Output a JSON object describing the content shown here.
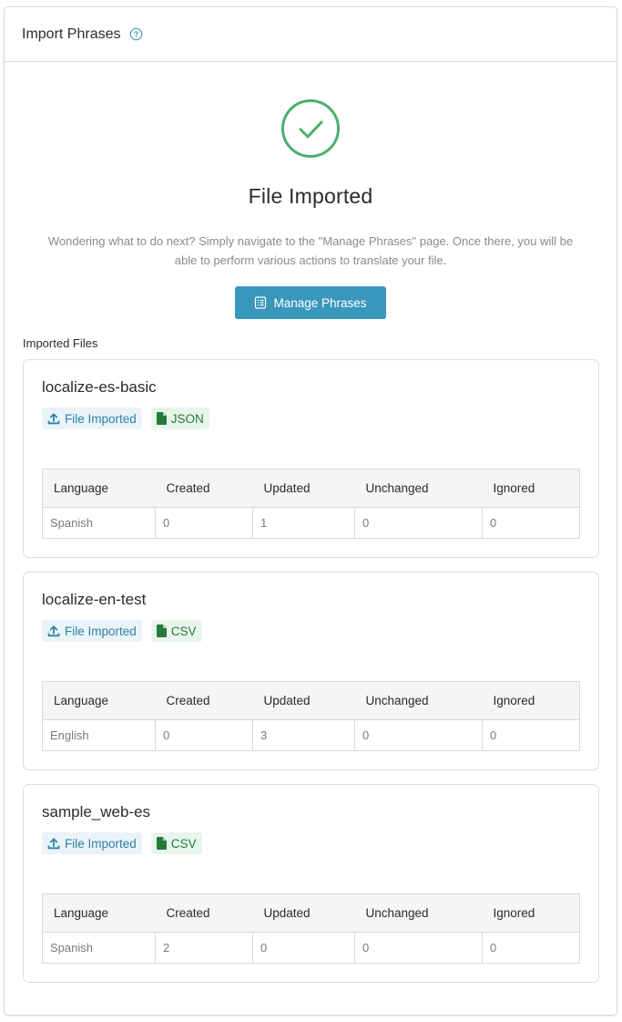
{
  "header": {
    "title": "Import Phrases",
    "help_icon": "question-circle-icon"
  },
  "success": {
    "icon": "check-circle-icon",
    "title": "File Imported",
    "description": "Wondering what to do next? Simply navigate to the \"Manage Phrases\" page. Once there, you will be able to perform various actions to translate your file.",
    "button_label": "Manage Phrases",
    "button_icon": "list-icon"
  },
  "imported_files_label": "Imported Files",
  "colors": {
    "accent": "#3a97bc",
    "success": "#4caf6e"
  },
  "columns": [
    "Language",
    "Created",
    "Updated",
    "Unchanged",
    "Ignored"
  ],
  "files": [
    {
      "name": "localize-es-basic",
      "status": "File Imported",
      "type": "JSON",
      "row": {
        "language": "Spanish",
        "created": "0",
        "updated": "1",
        "unchanged": "0",
        "ignored": "0"
      }
    },
    {
      "name": "localize-en-test",
      "status": "File Imported",
      "type": "CSV",
      "row": {
        "language": "English",
        "created": "0",
        "updated": "3",
        "unchanged": "0",
        "ignored": "0"
      }
    },
    {
      "name": "sample_web-es",
      "status": "File Imported",
      "type": "CSV",
      "row": {
        "language": "Spanish",
        "created": "2",
        "updated": "0",
        "unchanged": "0",
        "ignored": "0"
      }
    }
  ]
}
